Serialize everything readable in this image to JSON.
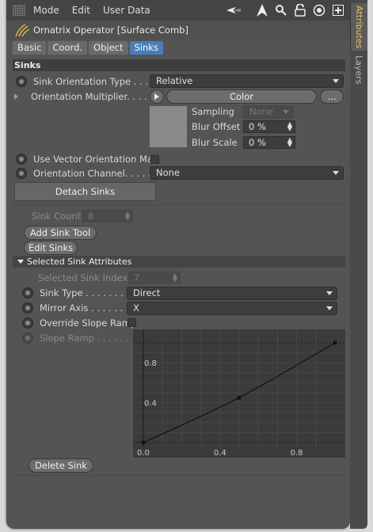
{
  "menu": {
    "items": [
      "Mode",
      "Edit",
      "User Data"
    ]
  },
  "object": {
    "title": "Ornatrix Operator [Surface Comb]"
  },
  "tabs": [
    "Basic",
    "Coord.",
    "Object",
    "Sinks"
  ],
  "side_tabs": {
    "attributes": "Attributes",
    "layers": "Layers"
  },
  "sinks": {
    "section_title": "Sinks",
    "orientation_type_label": "Sink Orientation Type . . . . .",
    "orientation_type_value": "Relative",
    "orientation_multiplier_label": "Orientation Multiplier. . . . .",
    "color_button": "Color",
    "ellipsis_button": "...",
    "sampling_label": "Sampling",
    "sampling_value": "None",
    "blur_offset_label": "Blur Offset",
    "blur_offset_value": "0 %",
    "blur_scale_label": "Blur Scale",
    "blur_scale_value": "0 %",
    "use_vector_map_label": "Use Vector Orientation Map",
    "orientation_channel_label": "Orientation Channel. . . . . . .",
    "orientation_channel_value": "None",
    "detach_button": "Detach Sinks",
    "sink_count_label": "Sink Count",
    "sink_count_value": "8",
    "add_sink_tool_button": "Add Sink Tool",
    "edit_sinks_button": "Edit Sinks"
  },
  "selected": {
    "section_title": "Selected Sink Attributes",
    "index_label": "Selected Sink Index",
    "index_value": "7",
    "sink_type_label": "Sink Type . . . . . . . . . .",
    "sink_type_value": "Direct",
    "mirror_axis_label": "Mirror Axis . . . . . . . . .",
    "mirror_axis_value": "X",
    "override_slope_label": "Override Slope Ramp",
    "slope_ramp_label": "Slope Ramp . . . . . .",
    "delete_button": "Delete Sink"
  },
  "chart_data": {
    "type": "line",
    "x": [
      0.0,
      0.5,
      1.0
    ],
    "y": [
      0.0,
      0.45,
      1.0
    ],
    "xlim": [
      0.0,
      1.0
    ],
    "ylim": [
      0.0,
      1.0
    ],
    "x_ticks": [
      "0.0",
      "0.4",
      "0.8"
    ],
    "y_ticks": [
      "0.4",
      "0.8"
    ],
    "grid": true
  }
}
